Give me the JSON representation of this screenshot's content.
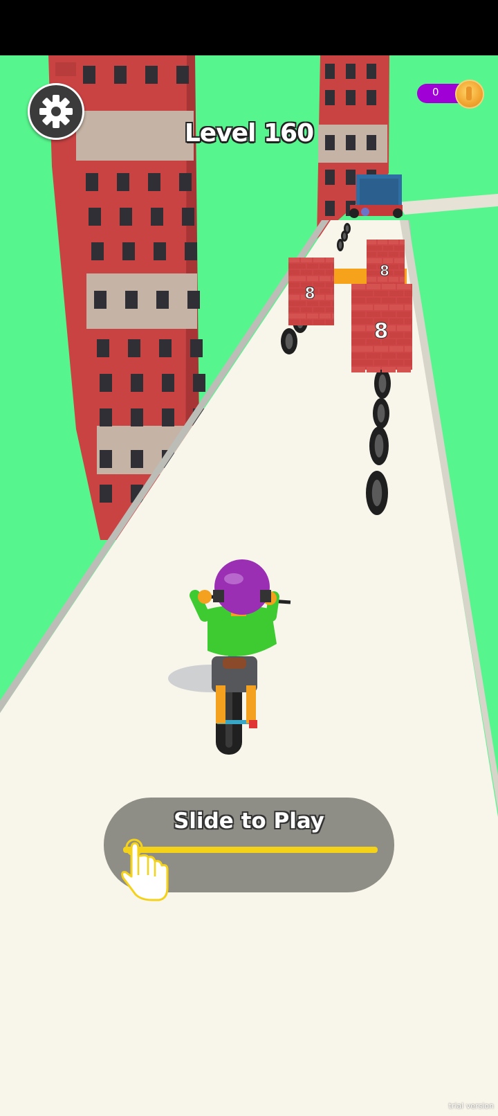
{
  "hud": {
    "level_label": "Level 160",
    "coin_count": "0",
    "settings_icon": "gear-icon",
    "coin_icon": "coin-icon"
  },
  "slider": {
    "label": "Slide to Play",
    "hand_icon": "pointing-hand-icon"
  },
  "obstacles": {
    "brick_wall_values": [
      "8",
      "8",
      "8"
    ]
  },
  "watermark": "trial version",
  "colors": {
    "sky": "#57f58d",
    "road": "#f8f5ea",
    "brick": "#cf4648",
    "slider_track": "#f4d21a",
    "coin_pill": "#a000d6",
    "helmet": "#9b2fb4",
    "shirt": "#3ecb32"
  }
}
